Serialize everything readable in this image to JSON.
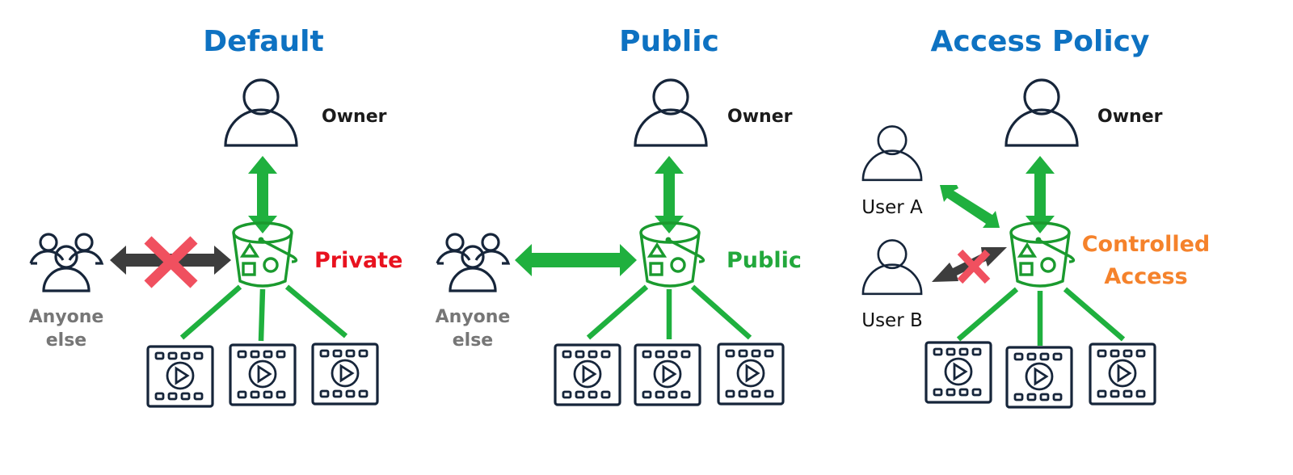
{
  "colors": {
    "title": "#0e72c2",
    "allowed_arrow": "#1fb03e",
    "denied_arrow": "#3d3d3d",
    "deny_cross": "#f0505f",
    "private": "#e8121f",
    "public": "#22a83c",
    "controlled": "#f5822b",
    "anyone_label": "#767676",
    "icon_stroke": "#16253a",
    "bucket_stroke": "#1a9a2e"
  },
  "panels": [
    {
      "id": "default",
      "title": "Default",
      "owner_label": "Owner",
      "others_label_line1": "Anyone",
      "others_label_line2": "else",
      "status_label": "Private",
      "status_color": "#e8121f",
      "others_access": "denied",
      "owner_access": "allowed",
      "objects": [
        "video-file",
        "video-file",
        "video-file"
      ]
    },
    {
      "id": "public",
      "title": "Public",
      "owner_label": "Owner",
      "others_label_line1": "Anyone",
      "others_label_line2": "else",
      "status_label": "Public",
      "status_color": "#22a83c",
      "others_access": "allowed",
      "owner_access": "allowed",
      "objects": [
        "video-file",
        "video-file",
        "video-file"
      ]
    },
    {
      "id": "access-policy",
      "title": "Access Policy",
      "owner_label": "Owner",
      "user_a_label": "User A",
      "user_b_label": "User B",
      "status_label_line1": "Controlled",
      "status_label_line2": "Access",
      "status_color": "#f5822b",
      "user_a_access": "allowed",
      "user_b_access": "denied",
      "owner_access": "allowed",
      "objects": [
        "video-file",
        "video-file",
        "video-file"
      ]
    }
  ]
}
